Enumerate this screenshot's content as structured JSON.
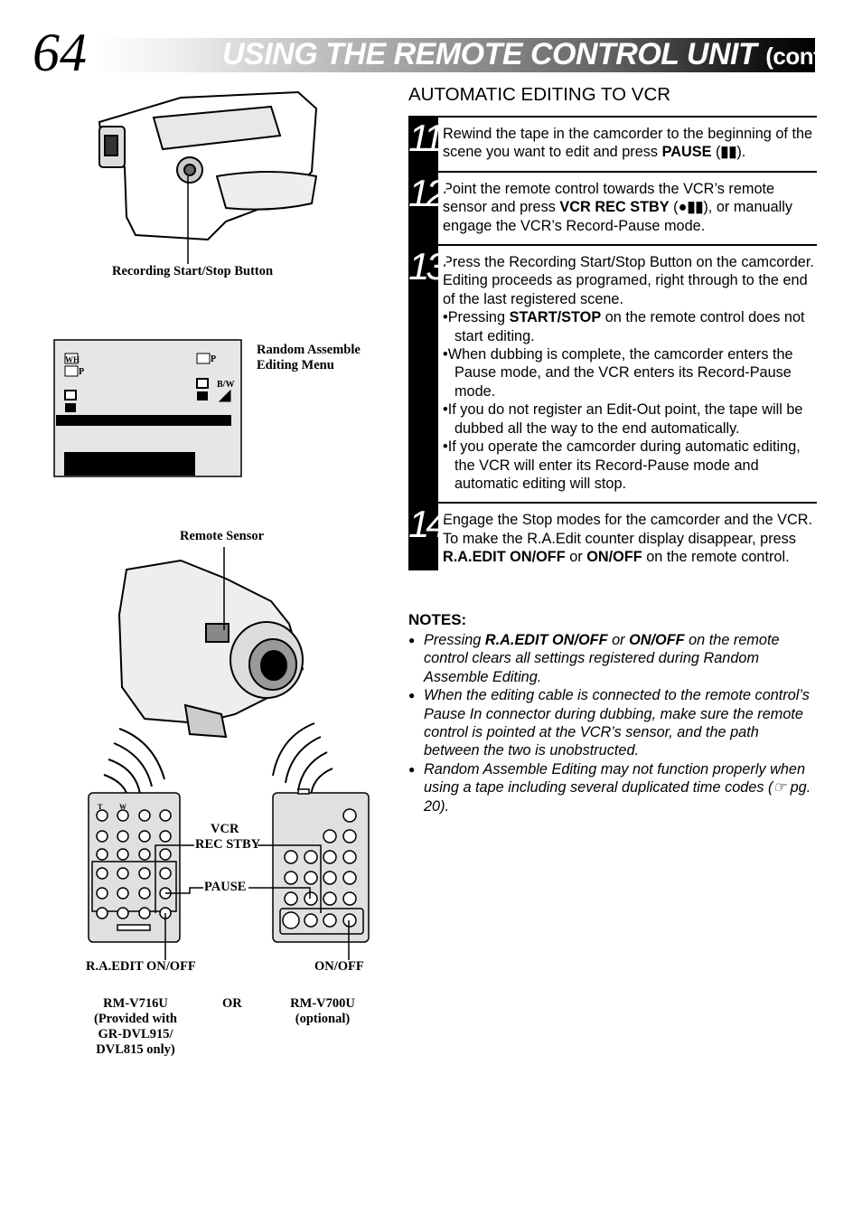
{
  "page_number": "64",
  "header": {
    "title": "USING THE REMOTE CONTROL UNIT",
    "suffix": "(cont.)"
  },
  "section_title": "AUTOMATIC EDITING TO VCR",
  "steps": [
    {
      "number": "11",
      "paragraphs": [
        {
          "bullet": false,
          "segments": [
            {
              "t": "Rewind the tape in the camcorder to the beginning of the scene you want to edit and press "
            },
            {
              "t": "PAUSE",
              "b": true
            },
            {
              "t": " ("
            },
            {
              "t": "▮▮",
              "b": true
            },
            {
              "t": ")."
            }
          ]
        }
      ]
    },
    {
      "number": "12",
      "paragraphs": [
        {
          "bullet": false,
          "segments": [
            {
              "t": "Point the remote control towards the VCR’s remote sensor and press "
            },
            {
              "t": "VCR REC STBY",
              "b": true
            },
            {
              "t": " ("
            },
            {
              "t": "●▮▮",
              "b": true
            },
            {
              "t": "), or manually engage the VCR’s Record-Pause mode."
            }
          ]
        }
      ]
    },
    {
      "number": "13",
      "paragraphs": [
        {
          "bullet": false,
          "segments": [
            {
              "t": "Press the Recording Start/Stop Button on the camcorder. Editing proceeds as programed, right through to the end of the last registered scene."
            }
          ]
        },
        {
          "bullet": true,
          "segments": [
            {
              "t": "•Pressing "
            },
            {
              "t": "START/STOP",
              "b": true
            },
            {
              "t": " on the remote control does not start editing."
            }
          ]
        },
        {
          "bullet": true,
          "segments": [
            {
              "t": "•When dubbing is complete, the camcorder enters the Pause mode, and the VCR enters its Record-Pause mode."
            }
          ]
        },
        {
          "bullet": true,
          "segments": [
            {
              "t": "•If you do not register an Edit-Out point, the tape will be dubbed all the way to the end automatically."
            }
          ]
        },
        {
          "bullet": true,
          "segments": [
            {
              "t": "•If you operate the camcorder during automatic editing, the VCR will enter its Record-Pause mode and automatic editing will stop."
            }
          ]
        }
      ]
    },
    {
      "number": "14",
      "paragraphs": [
        {
          "bullet": false,
          "segments": [
            {
              "t": "Engage the Stop modes for the camcorder and the VCR."
            }
          ]
        },
        {
          "bullet": false,
          "segments": [
            {
              "t": "To make the R.A.Edit counter display disappear, press "
            },
            {
              "t": "R.A.EDIT ON/OFF",
              "b": true
            },
            {
              "t": " or "
            },
            {
              "t": "ON/OFF",
              "b": true
            },
            {
              "t": " on the remote control."
            }
          ]
        }
      ]
    }
  ],
  "notes_title": "NOTES:",
  "notes": [
    [
      {
        "t": "Pressing "
      },
      {
        "t": "R.A.EDIT ON/OFF",
        "b": true
      },
      {
        "t": " or "
      },
      {
        "t": "ON/OFF",
        "b": true
      },
      {
        "t": " on the remote control clears all settings registered during Random Assemble Editing."
      }
    ],
    [
      {
        "t": "When the editing cable is connected to the remote control’s Pause In connector during dubbing, make sure the remote control is pointed at the VCR’s sensor, and the path between the two is unobstructed."
      }
    ],
    [
      {
        "t": "Random Assemble Editing may not function properly when using a tape including several duplicated time codes ("
      },
      {
        "t": "☞"
      },
      {
        "t": " pg. 20)."
      }
    ]
  ],
  "figures": {
    "rec_button_label": "Recording Start/Stop Button",
    "menu_label_1": "Random Assemble",
    "menu_label_2": "Editing Menu",
    "menu_icons": {
      "wh": "WH",
      "p1": "P",
      "p2": "P",
      "bw": "B/W"
    },
    "remote_sensor_label": "Remote Sensor",
    "vcr_label_1": "VCR",
    "vcr_label_2": "REC STBY",
    "pause_label": "PAUSE",
    "raedit_label": "R.A.EDIT ON/OFF",
    "onoff_label": "ON/OFF",
    "remote1_lines": [
      "RM-V716U",
      "(Provided with",
      "GR-DVL915/",
      "DVL815 only)"
    ],
    "or_label": "OR",
    "remote2_lines": [
      "RM-V700U",
      "(optional)"
    ],
    "remote1_keys": {
      "t": "T",
      "w": "W"
    }
  }
}
